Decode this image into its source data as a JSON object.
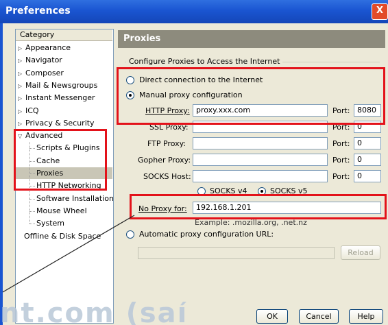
{
  "window": {
    "title": "Preferences",
    "close_glyph": "X"
  },
  "category": {
    "header": "Category",
    "items": [
      {
        "label": "Appearance",
        "indent": 0,
        "twisty": "▷"
      },
      {
        "label": "Navigator",
        "indent": 0,
        "twisty": "▷"
      },
      {
        "label": "Composer",
        "indent": 0,
        "twisty": "▷"
      },
      {
        "label": "Mail & Newsgroups",
        "indent": 0,
        "twisty": "▷"
      },
      {
        "label": "Instant Messenger",
        "indent": 0,
        "twisty": "▷"
      },
      {
        "label": "ICQ",
        "indent": 0,
        "twisty": "▷"
      },
      {
        "label": "Privacy & Security",
        "indent": 0,
        "twisty": "▷"
      },
      {
        "label": "Advanced",
        "indent": 0,
        "twisty": "▽"
      },
      {
        "label": "Scripts & Plugins",
        "indent": 1,
        "twisty": ""
      },
      {
        "label": "Cache",
        "indent": 1,
        "twisty": ""
      },
      {
        "label": "Proxies",
        "indent": 1,
        "twisty": "",
        "selected": true
      },
      {
        "label": "HTTP Networking",
        "indent": 1,
        "twisty": ""
      },
      {
        "label": "Software Installation",
        "indent": 1,
        "twisty": ""
      },
      {
        "label": "Mouse Wheel",
        "indent": 1,
        "twisty": ""
      },
      {
        "label": "System",
        "indent": 1,
        "twisty": ""
      },
      {
        "label": "Offline & Disk Space",
        "indent": 0,
        "twisty": ""
      }
    ]
  },
  "panel": {
    "title": "Proxies",
    "group_label": "Configure Proxies to Access the Internet",
    "direct_label": "Direct connection to the Internet",
    "manual_label": "Manual proxy configuration",
    "http_label": "HTTP Proxy:",
    "http_value": "proxy.xxx.com",
    "http_port": "8080",
    "ssl_label": "SSL Proxy:",
    "ssl_value": "",
    "ssl_port": "0",
    "ftp_label": "FTP Proxy:",
    "ftp_value": "",
    "ftp_port": "0",
    "gopher_label": "Gopher Proxy:",
    "gopher_value": "",
    "gopher_port": "0",
    "socks_label": "SOCKS Host:",
    "socks_value": "",
    "socks_port": "0",
    "port_label": "Port:",
    "socks4_label": "SOCKS v4",
    "socks5_label": "SOCKS v5",
    "noproxy_label": "No Proxy for:",
    "noproxy_value": "192.168.1.201",
    "example_text": "Example: .mozilla.org, .net.nz",
    "auto_label": "Automatic proxy configuration URL:",
    "auto_value": "",
    "reload_label": "Reload"
  },
  "footer": {
    "ok": "OK",
    "cancel": "Cancel",
    "help": "Help"
  },
  "watermark": "nt.com (saí"
}
